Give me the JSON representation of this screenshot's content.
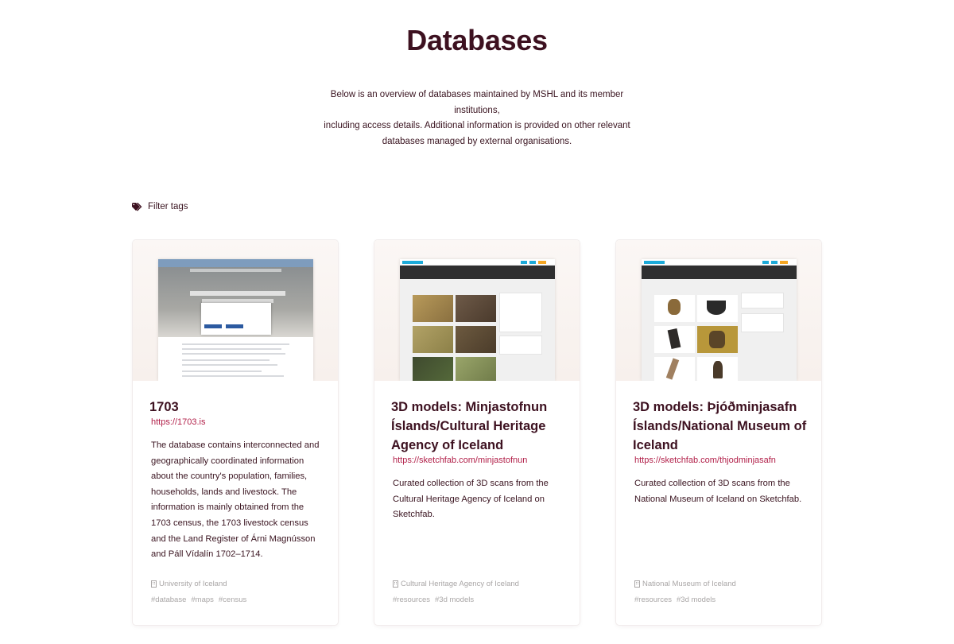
{
  "page": {
    "title": "Databases",
    "intro_line1": "Below is an overview of databases maintained by MSHL and its member institutions,",
    "intro_line2": "including access details. Additional information is provided on other relevant",
    "intro_line3": "databases managed by external organisations."
  },
  "filter": {
    "label": "Filter tags",
    "icon": "tags-icon"
  },
  "colors": {
    "title": "#3d1120",
    "link": "#b2214a",
    "muted": "#a9a6a6"
  },
  "cards": [
    {
      "title": "1703",
      "url": "https://1703.is",
      "description": "The database contains interconnected and geographically coordinated information about the country's population, families, households, lands and livestock. The information is mainly obtained from the 1703 census, the 1703 livestock census and the Land Register of Árni Magnússon and Páll Vídalín 1702–1714.",
      "institution": "University of Iceland",
      "institution_icon": "building-icon",
      "tags": [
        "#database",
        "#maps",
        "#census"
      ]
    },
    {
      "title": "3D models: Minjastofnun Íslands/Cultural Heritage Agency of Iceland",
      "url": "https://sketchfab.com/minjastofnun",
      "description": "Curated collection of 3D scans from the Cultural Heritage Agency of Iceland on Sketchfab.",
      "institution": "Cultural Heritage Agency of Iceland",
      "institution_icon": "building-icon",
      "tags": [
        "#resources",
        "#3d models"
      ]
    },
    {
      "title": "3D models: Þjóðminjasafn Íslands/National Museum of Iceland",
      "url": "https://sketchfab.com/thjodminjasafn",
      "description": "Curated collection of 3D scans from the National Museum of Iceland on Sketchfab.",
      "institution": "National Museum of Iceland",
      "institution_icon": "building-icon",
      "tags": [
        "#resources",
        "#3d models"
      ]
    }
  ]
}
